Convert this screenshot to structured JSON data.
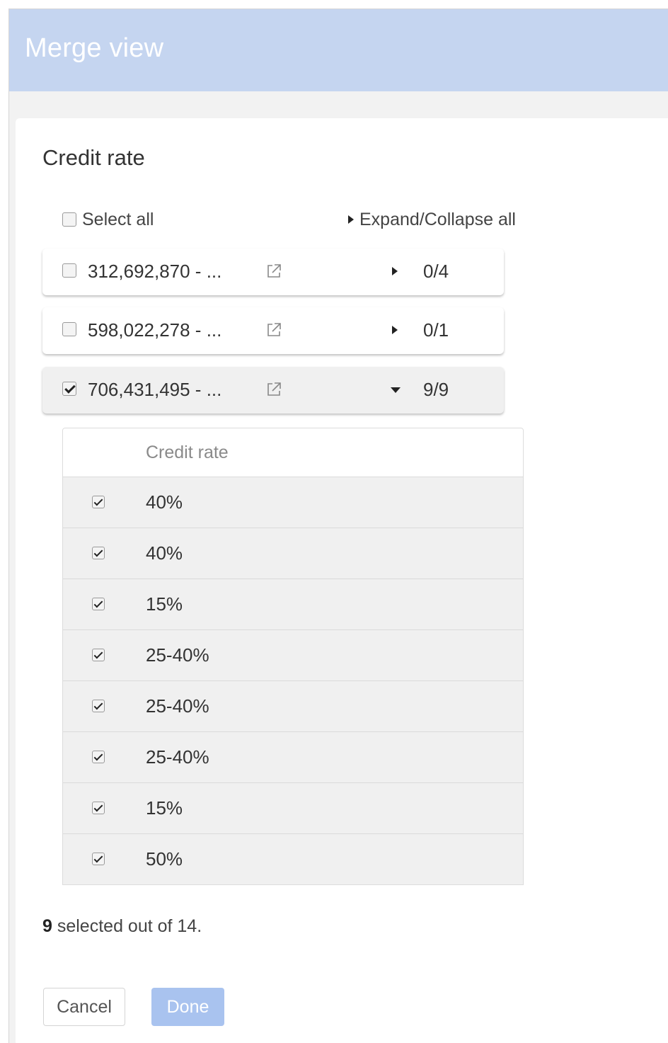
{
  "window": {
    "title": "Merge view"
  },
  "panel": {
    "heading": "Credit rate",
    "select_all_label": "Select all",
    "expand_collapse_label": "Expand/Collapse all"
  },
  "groups": [
    {
      "label": "312,692,870 - ...",
      "count": "0/4",
      "checked": false,
      "expanded": false
    },
    {
      "label": "598,022,278 - ...",
      "count": "0/1",
      "checked": false,
      "expanded": false
    },
    {
      "label": "706,431,495 - ...",
      "count": "9/9",
      "checked": true,
      "expanded": true
    }
  ],
  "subtable": {
    "column_header": "Credit rate",
    "rows": [
      {
        "value": "40%",
        "checked": true
      },
      {
        "value": "40%",
        "checked": true
      },
      {
        "value": "15%",
        "checked": true
      },
      {
        "value": "25-40%",
        "checked": true
      },
      {
        "value": "25-40%",
        "checked": true
      },
      {
        "value": "25-40%",
        "checked": true
      },
      {
        "value": "15%",
        "checked": true
      },
      {
        "value": "50%",
        "checked": true
      }
    ]
  },
  "summary": {
    "selected_count": "9",
    "text": " selected out of 14."
  },
  "buttons": {
    "cancel_label": "Cancel",
    "done_label": "Done"
  },
  "icons": {
    "external_link": "external-link-icon",
    "expand": "triangle-right-icon",
    "collapse": "triangle-down-icon"
  },
  "colors": {
    "titlebar": "#c5d5f0",
    "done_button": "#a9c3ef"
  }
}
